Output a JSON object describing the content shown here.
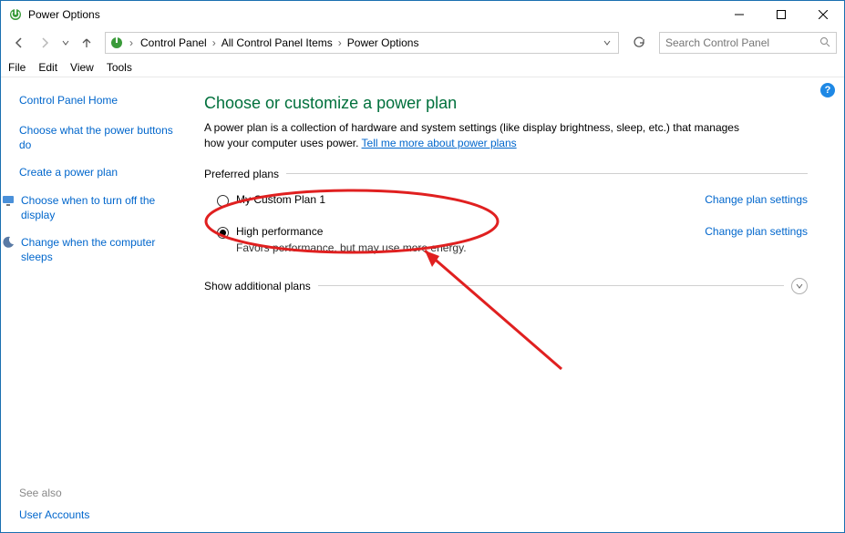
{
  "window": {
    "title": "Power Options"
  },
  "breadcrumb": {
    "items": [
      "Control Panel",
      "All Control Panel Items",
      "Power Options"
    ]
  },
  "search": {
    "placeholder": "Search Control Panel"
  },
  "menu": {
    "file": "File",
    "edit": "Edit",
    "view": "View",
    "tools": "Tools"
  },
  "sidebar": {
    "home": "Control Panel Home",
    "tasks": [
      "Choose what the power buttons do",
      "Create a power plan",
      "Choose when to turn off the display",
      "Change when the computer sleeps"
    ],
    "see_also_label": "See also",
    "user_accounts": "User Accounts"
  },
  "main": {
    "title": "Choose or customize a power plan",
    "desc_1": "A power plan is a collection of hardware and system settings (like display brightness, sleep, etc.) that manages how your computer uses power. ",
    "desc_link": "Tell me more about power plans",
    "preferred_label": "Preferred plans",
    "plans": [
      {
        "name": "My Custom Plan 1",
        "desc": "",
        "selected": false,
        "change_label": "Change plan settings"
      },
      {
        "name": "High performance",
        "desc": "Favors performance, but may use more energy.",
        "selected": true,
        "change_label": "Change plan settings"
      }
    ],
    "show_additional": "Show additional plans"
  },
  "help_badge": "?"
}
